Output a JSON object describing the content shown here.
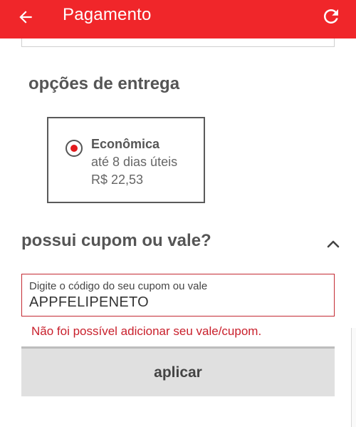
{
  "header": {
    "title": "Pagamento",
    "back_icon": "arrow-left-icon",
    "refresh_icon": "refresh-icon",
    "color": "#f0262a"
  },
  "delivery": {
    "section_title": "opções de entrega",
    "option": {
      "name": "Econômica",
      "time": "até 8 dias úteis",
      "price": "R$ 22,53",
      "selected": true
    }
  },
  "coupon": {
    "section_title": "possui cupom ou vale?",
    "expanded": true,
    "field_label": "Digite o código do seu cupom ou vale",
    "field_value": "APPFELIPENETO",
    "error_message": "Não foi possível adicionar seu vale/cupom.",
    "apply_label": "aplicar",
    "error_color": "#c9202c"
  }
}
